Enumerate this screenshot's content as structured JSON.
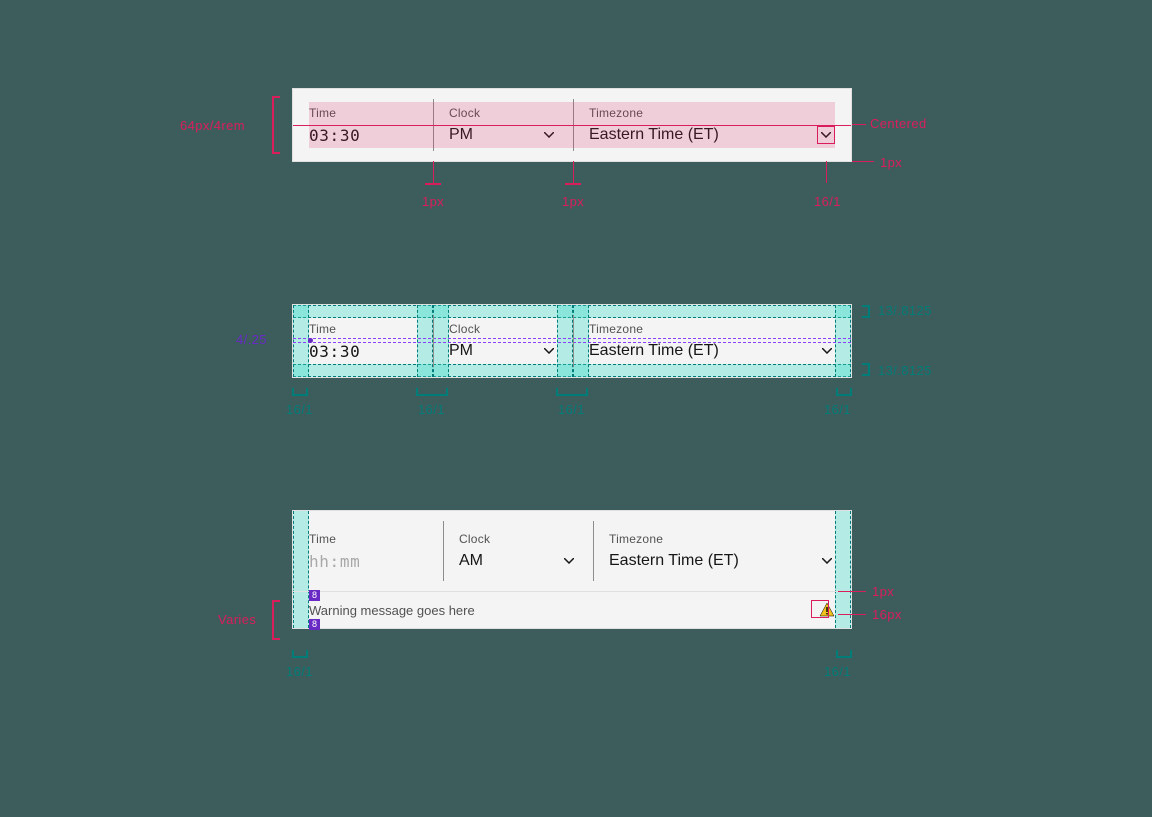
{
  "panel1": {
    "time_label": "Time",
    "time_value": "03:30",
    "clock_label": "Clock",
    "clock_value": "PM",
    "tz_label": "Timezone",
    "tz_value": "Eastern Time (ET)",
    "height_annot": "64px/4rem",
    "centered_annot": "Centered",
    "border_annot": "1px",
    "divider1_annot": "1px",
    "divider2_annot": "1px",
    "icon_annot": "16/1"
  },
  "panel2": {
    "time_label": "Time",
    "time_value": "03:30",
    "clock_label": "Clock",
    "clock_value": "PM",
    "tz_label": "Timezone",
    "tz_value": "Eastern Time (ET)",
    "gap_annot": "4/.25",
    "top_pad_annot": "13/.8125",
    "bottom_pad_annot": "13/.8125",
    "col_annot": "16/1"
  },
  "panel3": {
    "time_label": "Time",
    "time_placeholder": "hh:mm",
    "clock_label": "Clock",
    "clock_value": "AM",
    "tz_label": "Timezone",
    "tz_value": "Eastern Time (ET)",
    "warning_text": "Warning message goes here",
    "varies_annot": "Varies",
    "border_annot": "1px",
    "icon_annot": "16px",
    "col_annot": "16/1",
    "spacer_annot": "8"
  }
}
